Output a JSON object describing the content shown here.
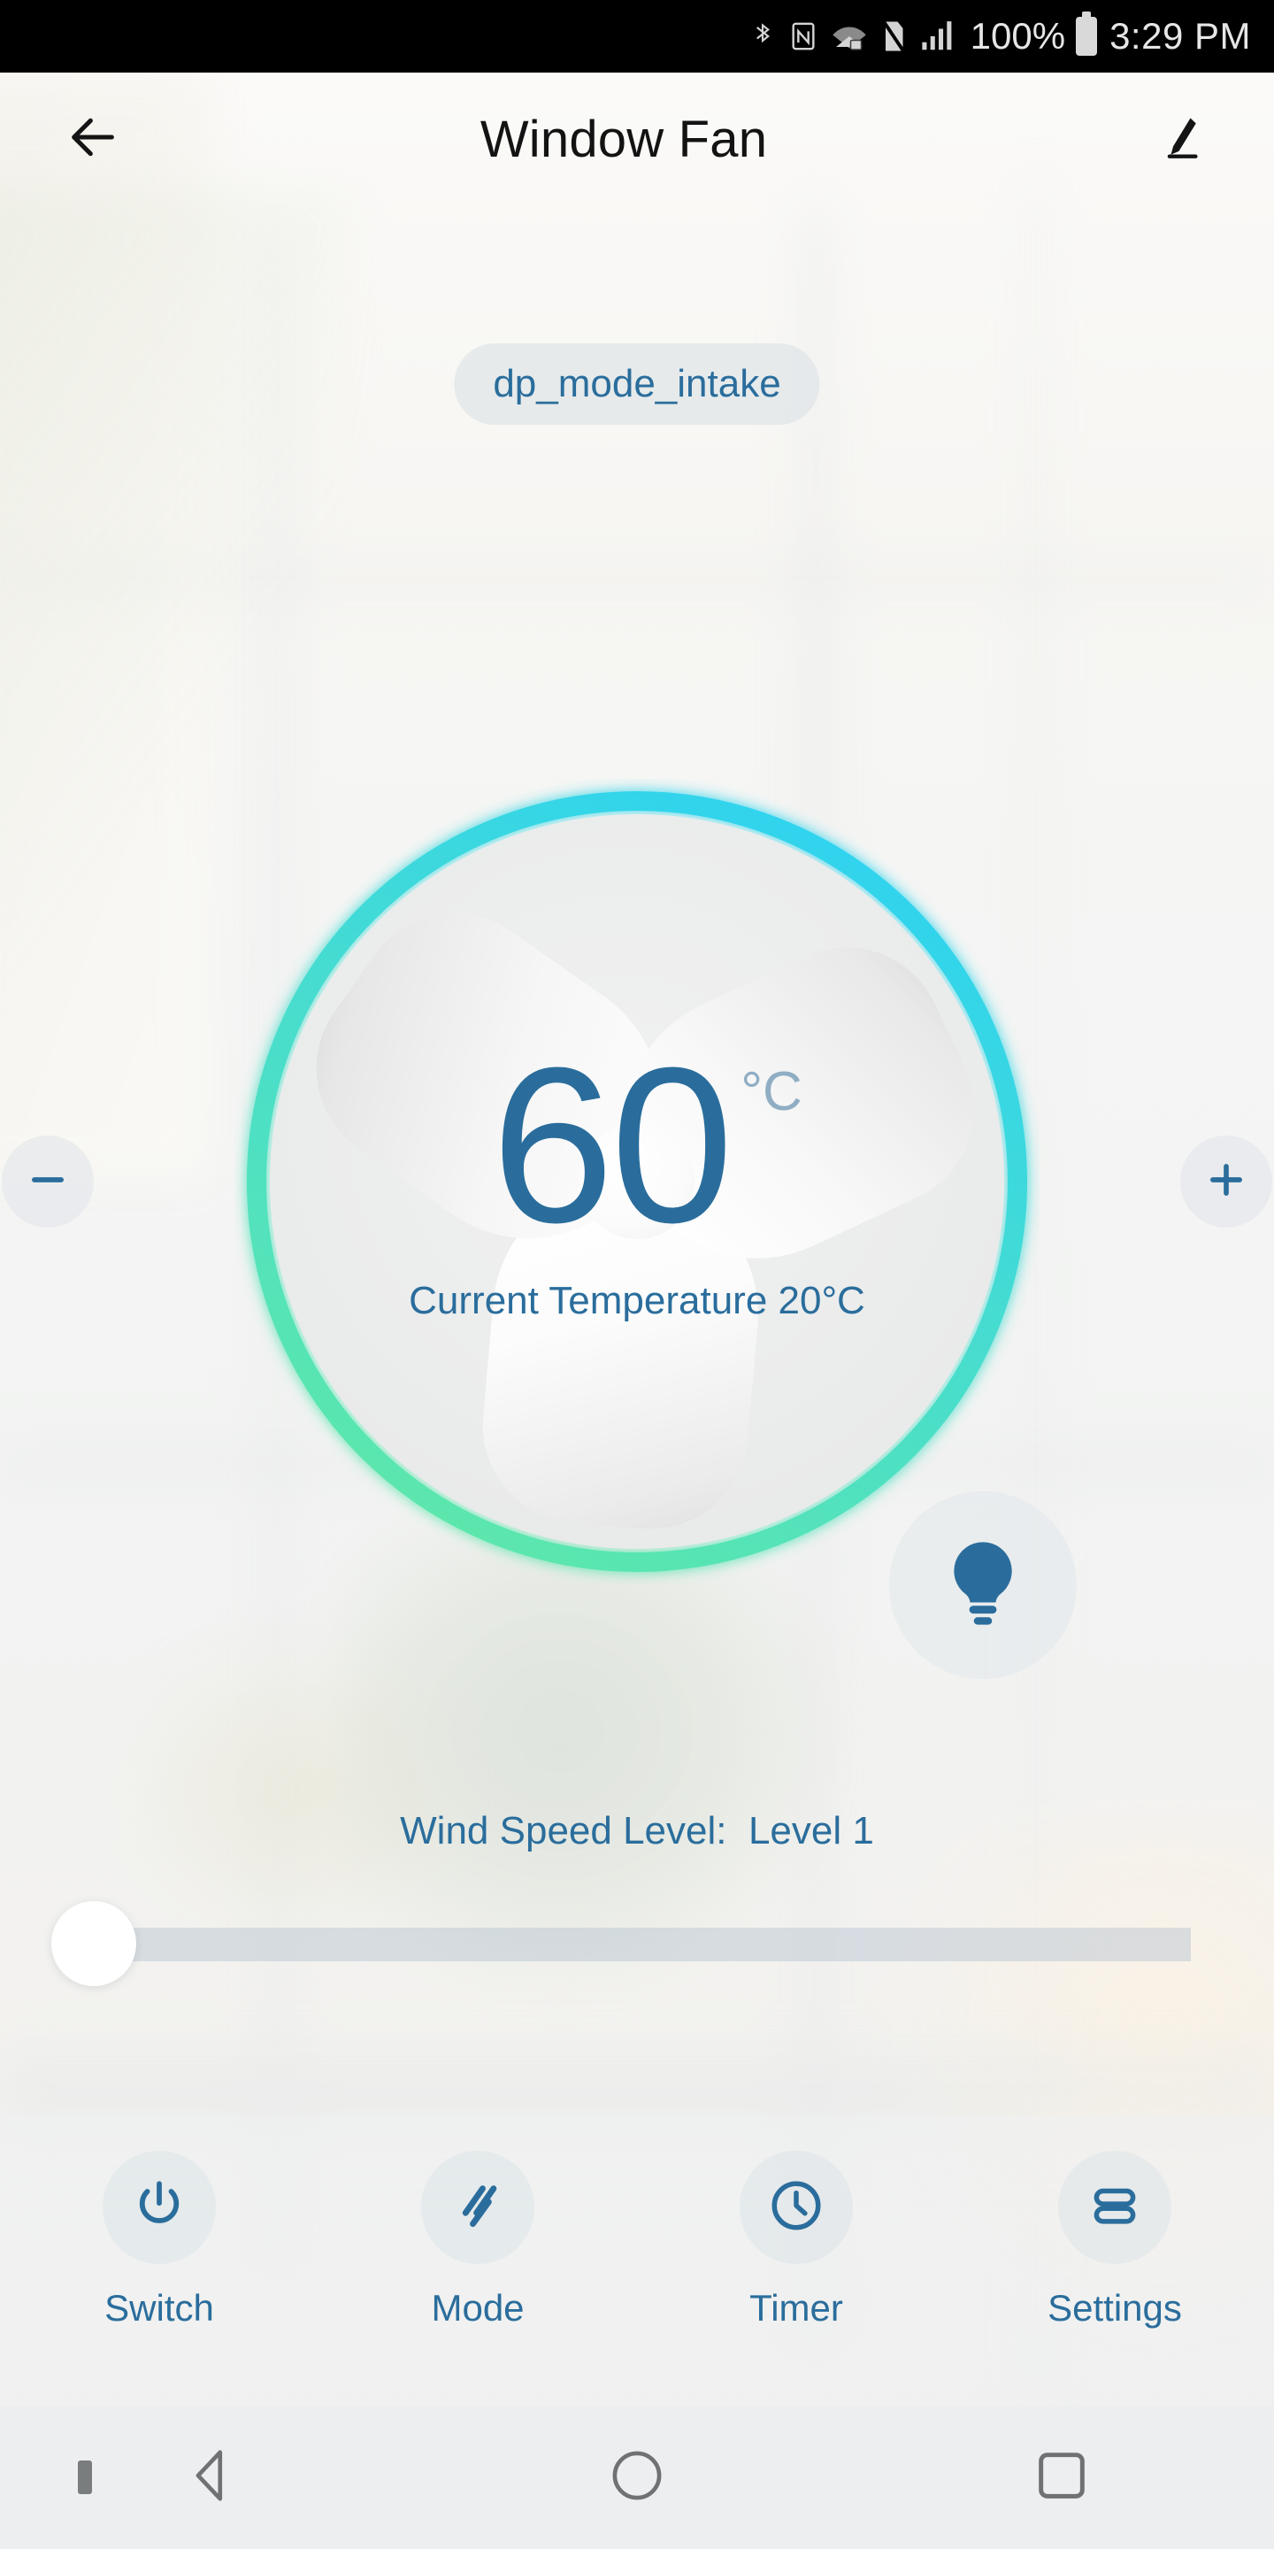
{
  "statusbar": {
    "icons": [
      "bluetooth-icon",
      "nfc-icon",
      "wifi-locked-icon",
      "no-sim-icon",
      "cell-signal-icon"
    ],
    "battery_percent": "100%",
    "battery_icon": "battery-full-icon",
    "time": "3:29 PM"
  },
  "header": {
    "back_icon": "back-arrow-icon",
    "title": "Window Fan",
    "edit_icon": "pencil-edit-icon"
  },
  "mode_pill": {
    "label": "dp_mode_intake"
  },
  "dial": {
    "value": "60",
    "unit": "°C",
    "current_temperature": "Current Temperature 20°C",
    "ring_color_start": "#2ed3f0",
    "ring_color_end": "#5ee8a8",
    "value_color": "#2a6d9c",
    "unit_color": "#8fadc3"
  },
  "stepper": {
    "decrease_icon": "minus-icon",
    "increase_icon": "plus-icon"
  },
  "bulb": {
    "icon": "light-bulb-icon",
    "color": "#2a6d9c"
  },
  "wind": {
    "label": "Wind Speed Level:  Level 1",
    "level_value": 1,
    "slider_min": 1,
    "slider_max": 4,
    "thumb_position_percent": 0
  },
  "actions": [
    {
      "label": "Switch",
      "icon": "power-icon"
    },
    {
      "label": "Mode",
      "icon": "slashes-mode-icon"
    },
    {
      "label": "Timer",
      "icon": "clock-icon"
    },
    {
      "label": "Settings",
      "icon": "stacked-bars-settings-icon"
    }
  ],
  "navbar": {
    "dot_icon": "keyboard-indicator-dot",
    "back_icon": "nav-back-triangle-icon",
    "home_icon": "nav-home-circle-icon",
    "recents_icon": "nav-recents-square-icon"
  }
}
